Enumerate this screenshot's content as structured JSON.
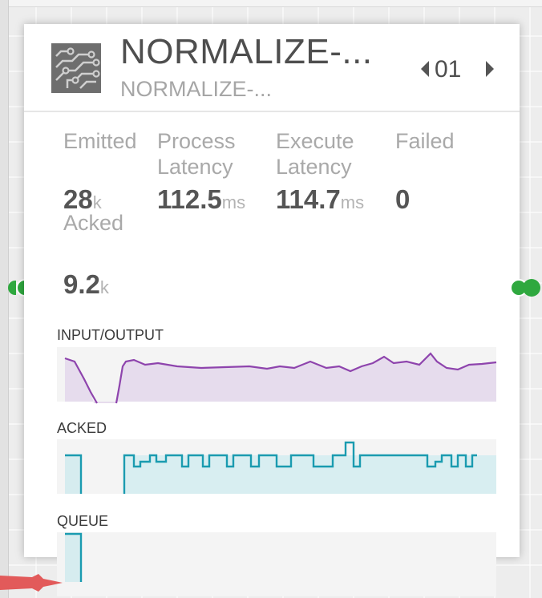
{
  "node": {
    "title": "NORMALIZE-...",
    "subtitle": "NORMALIZE-...",
    "icon": "circuit-board-icon",
    "instance": "01",
    "colors": {
      "port": "#2fa83f",
      "io_line": "#8e44ad",
      "acked_line": "#1a9bb0",
      "edge": "#e25a5a"
    }
  },
  "metrics": {
    "emitted": {
      "label": "Emitted",
      "value": "28",
      "unit": "k"
    },
    "process_latency": {
      "label_line1": "Process",
      "label_line2": "Latency",
      "value": "112.5",
      "unit": "ms"
    },
    "execute_latency": {
      "label_line1": "Execute",
      "label_line2": "Latency",
      "value": "114.7",
      "unit": "ms"
    },
    "failed": {
      "label": "Failed",
      "value": "0"
    },
    "acked": {
      "label": "Acked",
      "value": "9.2",
      "unit": "k"
    }
  },
  "sparklines": {
    "io_label": "INPUT/OUTPUT",
    "acked_label": "ACKED",
    "queue_label": "QUEUE"
  }
}
